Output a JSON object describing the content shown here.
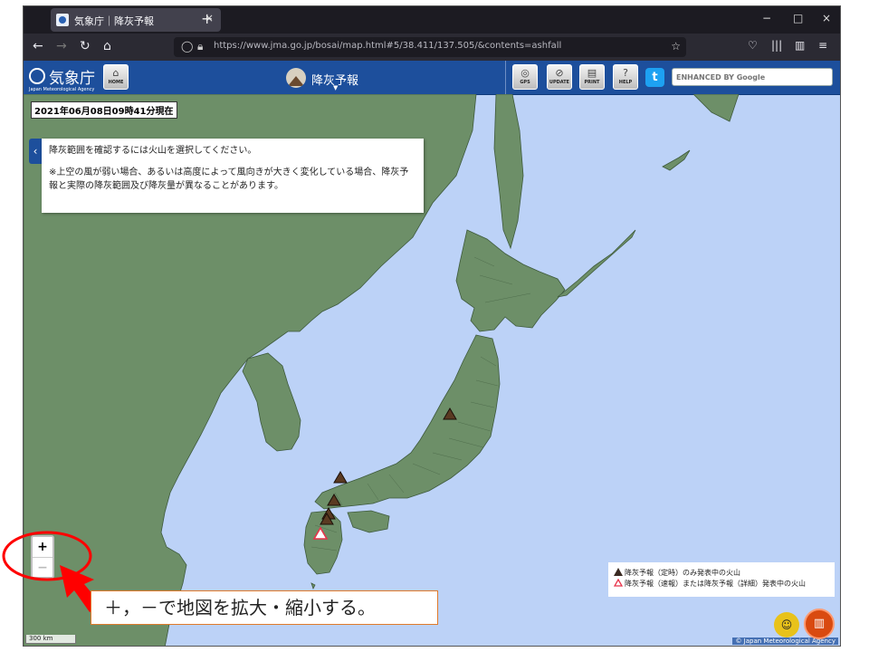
{
  "browser": {
    "tab_title": "気象庁｜降灰予報",
    "tab_close": "×",
    "new_tab": "+",
    "window_controls": [
      "−",
      "□",
      "×"
    ],
    "url": "https://www.jma.go.jp/bosai/map.html#5/38.411/137.505/&contents=ashfall"
  },
  "header": {
    "logo_text": "気象庁",
    "logo_subtext": "Japan Meteorological Agency",
    "home_label": "HOME",
    "title": "降灰予報",
    "buttons": [
      "GPS",
      "UPDATE",
      "PRINT",
      "HELP"
    ],
    "search_placeholder": "ENHANCED BY Google"
  },
  "map": {
    "timestamp": "2021年06月08日09時41分現在",
    "info_line1": "降灰範囲を確認するには火山を選択してください。",
    "info_line2": "※上空の風が弱い場合、あるいは高度によって風向きが大きく変化している場合、降灰予報と実際の降灰範囲及び降灰量が異なることがあります。",
    "zoom_in": "+",
    "zoom_out": "−",
    "legend_item1": "降灰予報（定時）のみ発表中の火山",
    "legend_item2": "降灰予報（速報）または降灰予報（詳細）発表中の火山",
    "scale": "300 km",
    "copyright": "© Japan Meteorological Agency"
  },
  "annotation": {
    "callout_text": "＋，－で地図を拡大・縮小する。"
  },
  "colors": {
    "sea": "#bcd2f7",
    "land": "#6d8f68",
    "header": "#1d4f9c",
    "annotation_red": "#ff0000"
  }
}
